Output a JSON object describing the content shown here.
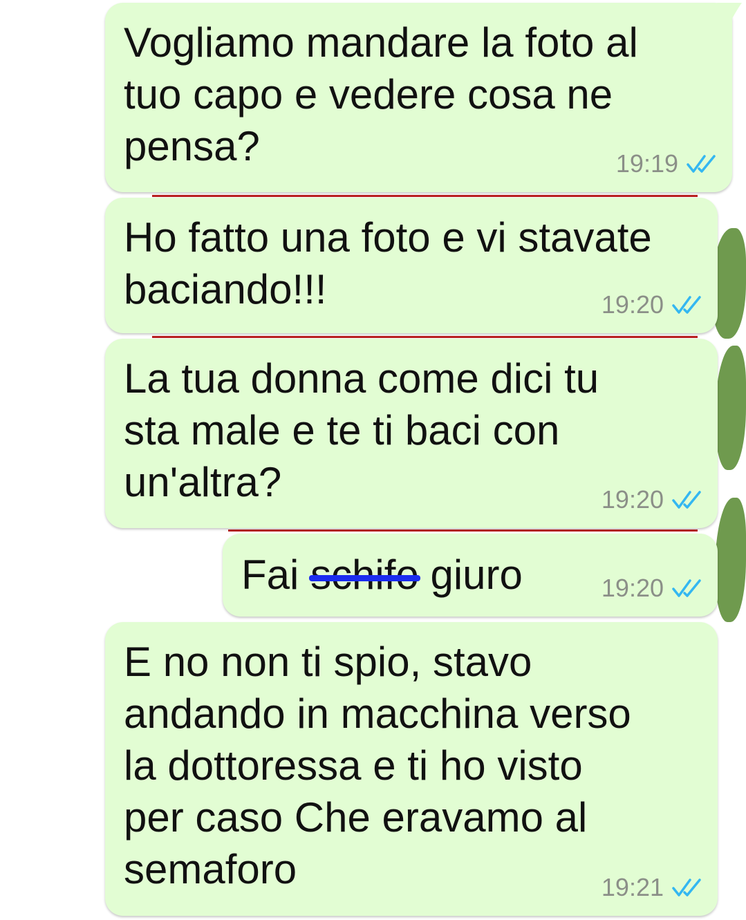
{
  "chat": {
    "messages": [
      {
        "text": "Vogliamo mandare la foto al\ntuo capo e vedere cosa ne\npensa?",
        "time": "19:19",
        "status_icon": "double-check-read-icon"
      },
      {
        "text": "Ho fatto una foto e vi stavate\nbaciando!!!",
        "time": "19:20",
        "status_icon": "double-check-read-icon"
      },
      {
        "text": "La tua donna come dici tu\nsta male e te ti baci con\nun'altra?",
        "time": "19:20",
        "status_icon": "double-check-read-icon"
      },
      {
        "text_before": "Fai",
        "text_struck": "schifo",
        "text_after": "giuro",
        "time": "19:20",
        "status_icon": "double-check-read-icon"
      },
      {
        "text": "E no non ti spio, stavo\nandando in macchina verso\nla dottoressa e ti ho visto\nper caso Che eravamo al\nsemaforo",
        "time": "19:21",
        "status_icon": "double-check-read-icon"
      }
    ]
  },
  "colors": {
    "bubble_outgoing": "#e2fdd3",
    "tick_read": "#34b7f1",
    "timestamp": "#8b8f88",
    "strike_mark": "#1b2cf0"
  }
}
